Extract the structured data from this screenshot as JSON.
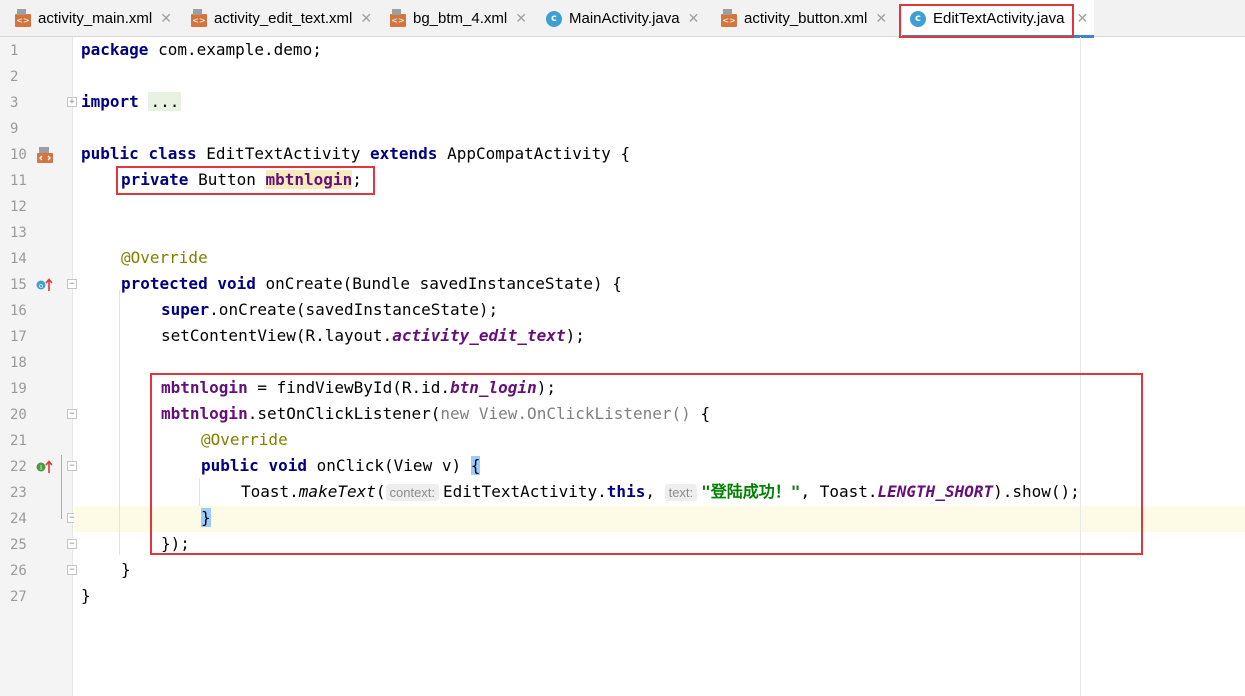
{
  "tabs": [
    {
      "label": "activity_main.xml",
      "type": "xml",
      "icon": "xml-file-icon"
    },
    {
      "label": "activity_edit_text.xml",
      "type": "xml",
      "icon": "xml-file-icon"
    },
    {
      "label": "bg_btm_4.xml",
      "type": "xml",
      "icon": "xml-file-icon"
    },
    {
      "label": "MainActivity.java",
      "type": "java",
      "icon": "java-class-icon"
    },
    {
      "label": "activity_button.xml",
      "type": "xml",
      "icon": "xml-file-icon"
    },
    {
      "label": "EditTextActivity.java",
      "type": "java",
      "icon": "java-class-icon",
      "active": true
    }
  ],
  "tab_close_glyph": "✕",
  "line_numbers": [
    "1",
    "2",
    "3",
    "9",
    "10",
    "11",
    "12",
    "13",
    "14",
    "15",
    "16",
    "17",
    "18",
    "19",
    "20",
    "21",
    "22",
    "23",
    "24",
    "25",
    "26",
    "27"
  ],
  "code": {
    "l1_kw": "package",
    "l1_rest": " com.example.demo;",
    "l3_kw": "import",
    "l3_fold": "...",
    "l10_kw1": "public",
    "l10_kw2": "class",
    "l10_name": " EditTextActivity ",
    "l10_kw3": "extends",
    "l10_rest": " AppCompatActivity {",
    "l11_kw": "private",
    "l11_type": " Button ",
    "l11_field": "mbtnlogin",
    "l11_end": ";",
    "l14_ann": "@Override",
    "l15_kw1": "protected",
    "l15_kw2": "void",
    "l15_rest": " onCreate(Bundle savedInstanceState) {",
    "l16_kw": "super",
    "l16_rest": ".onCreate(savedInstanceState);",
    "l17_a": "setContentView(R.layout.",
    "l17_sf": "activity_edit_text",
    "l17_b": ");",
    "l19_field": "mbtnlogin",
    "l19_a": " = findViewById(R.id.",
    "l19_sf": "btn_login",
    "l19_b": ");",
    "l20_field": "mbtnlogin",
    "l20_a": ".setOnClickListener(",
    "l20_gray": "new View.OnClickListener()",
    "l20_b": " {",
    "l21_ann": "@Override",
    "l22_kw1": "public",
    "l22_kw2": "void",
    "l22_rest": " onClick(View v) ",
    "l22_brace": "{",
    "l23_a": "Toast.",
    "l23_it": "makeText",
    "l23_b": "(",
    "l23_hint1": "context:",
    "l23_c": "EditTextActivity.",
    "l23_this": "this",
    "l23_d": ", ",
    "l23_hint2": "text:",
    "l23_str": "\"登陆成功！\"",
    "l23_e": ", Toast.",
    "l23_sf": "LENGTH_SHORT",
    "l23_f": ").show();",
    "l24_brace": "}",
    "l25": "});",
    "l26": "}",
    "l27": "}"
  }
}
